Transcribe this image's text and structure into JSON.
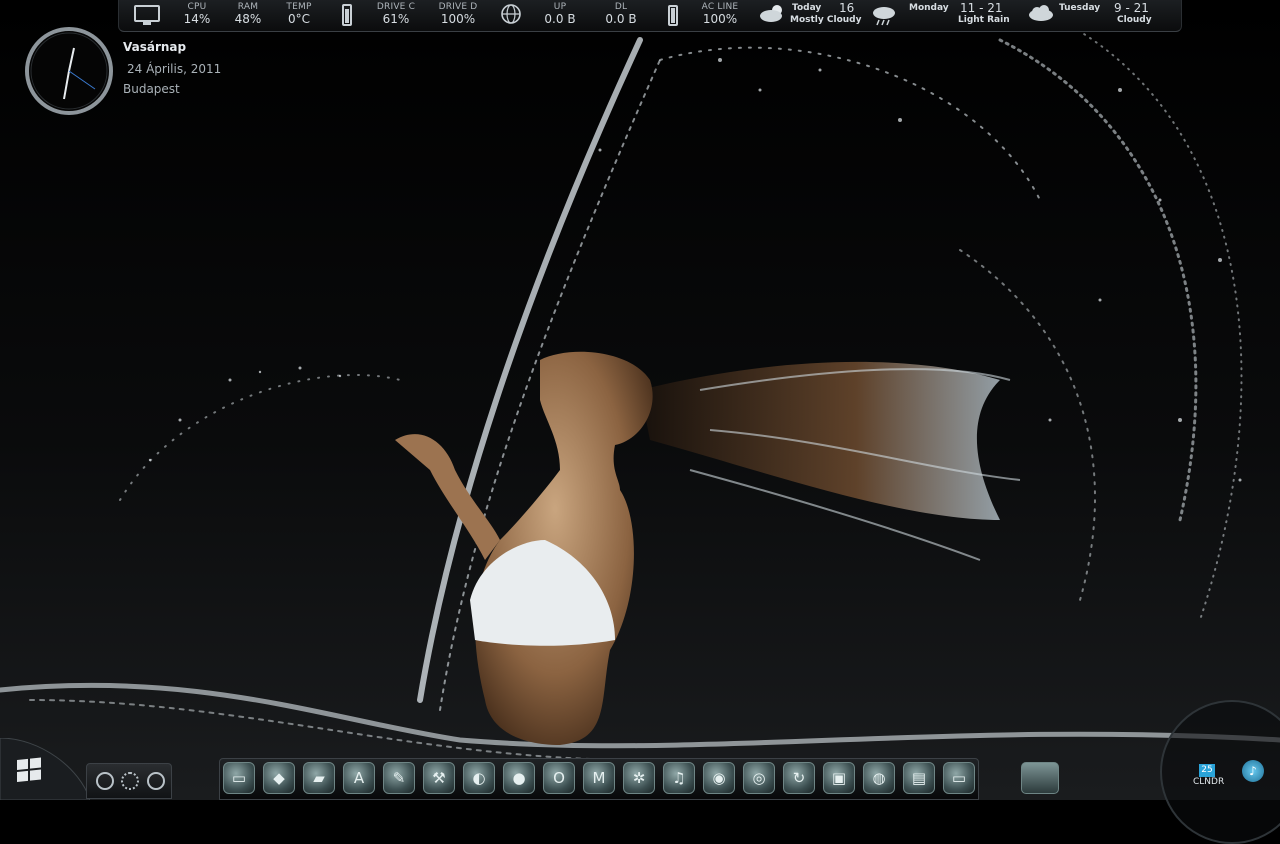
{
  "topbar": {
    "stats": [
      {
        "label": "CPU",
        "value": "14%"
      },
      {
        "label": "RAM",
        "value": "48%"
      },
      {
        "label": "TEMP",
        "value": "0°C"
      },
      {
        "label": "DRIVE C",
        "value": "61%"
      },
      {
        "label": "DRIVE D",
        "value": "100%"
      },
      {
        "label": "UP",
        "value": "0.0 B"
      },
      {
        "label": "DL",
        "value": "0.0 B"
      },
      {
        "label": "AC LINE",
        "value": "100%"
      }
    ],
    "icons": [
      "monitor-icon",
      "battery-small-icon",
      "globe-icon",
      "battery-icon"
    ],
    "weather": [
      {
        "day": "Today",
        "temp": "16",
        "condition": "Mostly Cloudy",
        "icon": "partly-cloudy-icon"
      },
      {
        "day": "Monday",
        "temp": "11 - 21",
        "condition": "Light Rain",
        "icon": "rain-cloud-icon"
      },
      {
        "day": "Tuesday",
        "temp": "9 - 21",
        "condition": "Cloudy",
        "icon": "cloud-icon"
      }
    ]
  },
  "clock": {
    "day": "Vasárnap",
    "date": "24 Április, 2011",
    "city": "Budapest"
  },
  "dock": {
    "icons": [
      "computer-icon",
      "drive-icon",
      "folder-icon",
      "font-viewer-icon",
      "edit-icon",
      "tools-icon",
      "media-icon",
      "disc-icon",
      "opera-icon",
      "app-icon",
      "film-reel-icon",
      "music-icon",
      "dvd-icon",
      "cd-icon",
      "sync-icon",
      "camera-icon",
      "globe-icon",
      "photo-icon",
      "monitor-icon"
    ]
  },
  "tray": {
    "calendar_day": "25",
    "calendar_label": "CLNDR"
  },
  "colors": {
    "accent": "#2aa3d8",
    "bar": "#0b0c0d",
    "dock_icon": "#3d5052"
  }
}
